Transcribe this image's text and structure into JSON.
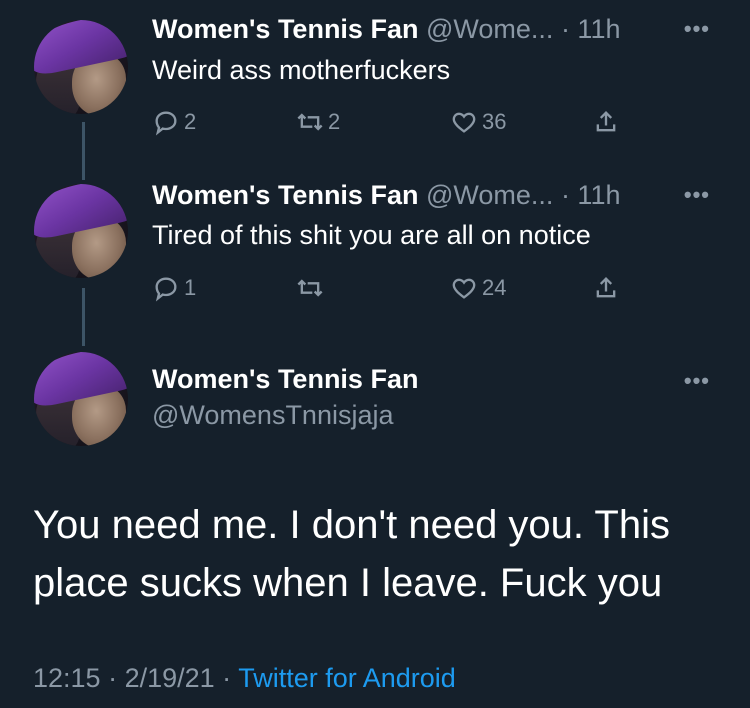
{
  "tweets": [
    {
      "name": "Women's Tennis Fan",
      "handle": "@Wome...",
      "time": "· 11h",
      "text": "Weird ass motherfuckers",
      "replies": "2",
      "retweets": "2",
      "likes": "36"
    },
    {
      "name": "Women's Tennis Fan",
      "handle": "@Wome...",
      "time": "· 11h",
      "text": "Tired of this shit you are all on notice",
      "replies": "1",
      "retweets": "",
      "likes": "24"
    }
  ],
  "main_tweet": {
    "name": "Women's Tennis Fan",
    "handle": "@WomensTnnisjaja",
    "text_line1": "You need me. I don't need you. This",
    "text_line2": "place sucks when I leave. Fuck you",
    "time": "12:15",
    "sep1": " · ",
    "date": "2/19/21",
    "sep2": " · ",
    "source": "Twitter for Android"
  },
  "icons": {
    "reply": "reply-icon",
    "retweet": "retweet-icon",
    "like": "heart-icon",
    "share": "share-icon",
    "more": "more-icon"
  },
  "colors": {
    "background": "#15202b",
    "secondary_text": "#8b98a5",
    "link": "#1d9bf0"
  }
}
